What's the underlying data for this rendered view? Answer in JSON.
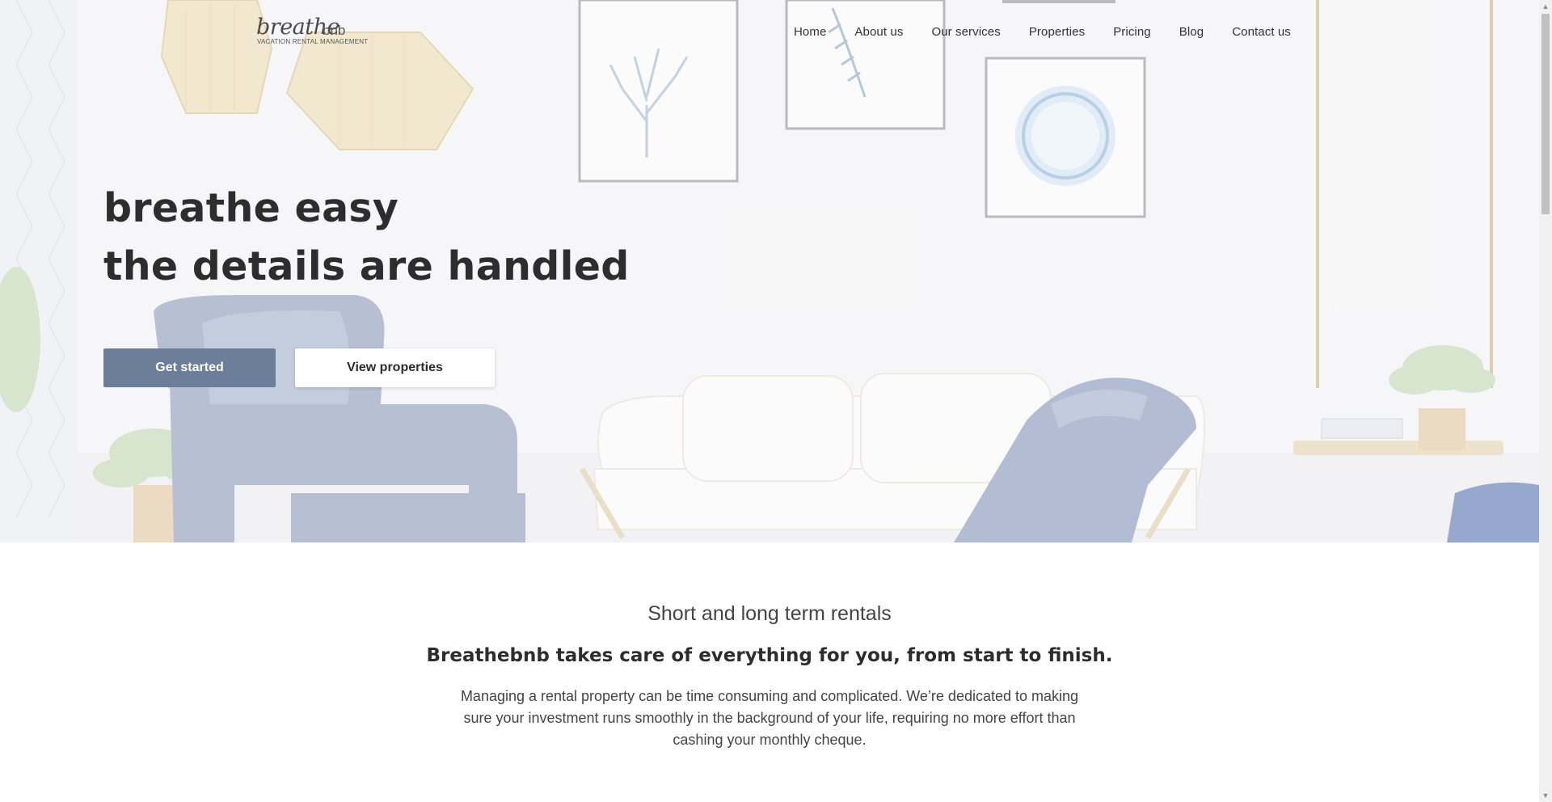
{
  "logo": {
    "main": "breathe",
    "suffix": "bnb",
    "tagline": "VACATION RENTAL MANAGEMENT"
  },
  "nav": {
    "items": [
      "Home",
      "About us",
      "Our services",
      "Properties",
      "Pricing",
      "Blog",
      "Contact us"
    ]
  },
  "hero": {
    "headline_line1": "breathe easy",
    "headline_line2": "the details are handled",
    "primary_button": "Get started",
    "secondary_button": "View properties"
  },
  "intro": {
    "kicker": "Short and long term rentals",
    "title": "Breathebnb takes care of everything for you, from start to finish.",
    "body": "Managing a rental property can be time consuming and complicated. We’re dedicated to making sure your investment runs smoothly in the background of your life, requiring no more effort than cashing your monthly cheque."
  },
  "colors": {
    "primary_button": "#6b7f9b",
    "text_dark": "#2d2d2d",
    "hero_bg": "#f6f6f8"
  },
  "icons": [
    "chevron-up-icon",
    "chevron-down-icon"
  ]
}
